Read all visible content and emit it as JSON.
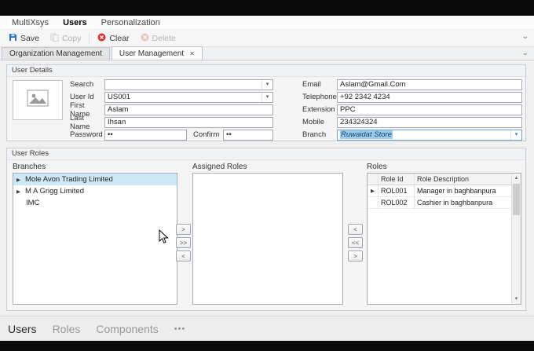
{
  "icons": {
    "chevron_down": "⌄",
    "dropdown": "▾",
    "expander": "▶",
    "row_selector": "▶",
    "scroll_up": "▲",
    "scroll_down": "▼",
    "close": "✕",
    "ellipsis": "•••"
  },
  "menubar": {
    "items": [
      {
        "label": "MultiXsys"
      },
      {
        "label": "Users"
      },
      {
        "label": "Personalization"
      }
    ]
  },
  "toolbar": {
    "buttons": [
      {
        "label": "Save",
        "enabled": true
      },
      {
        "label": "Copy",
        "enabled": false
      },
      {
        "label": "Clear",
        "enabled": true
      },
      {
        "label": "Delete",
        "enabled": false
      }
    ]
  },
  "tabstrip": {
    "tabs": [
      {
        "label": "Organization Management",
        "active": false
      },
      {
        "label": "User Management",
        "active": true
      }
    ]
  },
  "user_details": {
    "title": "User Details",
    "search": {
      "label": "Search",
      "value": ""
    },
    "user_id": {
      "label": "User Id",
      "value": "US001"
    },
    "first_name": {
      "label": "First Name",
      "value": "Aslam"
    },
    "last_name": {
      "label": "Last Name",
      "value": "Ihsan"
    },
    "password": {
      "label": "Password",
      "value": "••"
    },
    "confirm": {
      "label": "Confirm",
      "value": "••"
    },
    "email": {
      "label": "Email",
      "value": "Aslam@Gmail.Com"
    },
    "telephone": {
      "label": "Telephone",
      "value": "+92 2342 4234"
    },
    "extension": {
      "label": "Extension",
      "value": "PPC"
    },
    "mobile": {
      "label": "Mobile",
      "value": "234324324"
    },
    "branch": {
      "label": "Branch",
      "value": "Ruwaidat Store"
    }
  },
  "user_roles": {
    "title": "User Roles",
    "branches": {
      "label": "Branches",
      "items": [
        {
          "label": "Mole Avon Trading Limited",
          "selected": true,
          "has_children": true
        },
        {
          "label": "M A Grigg Limited",
          "selected": false,
          "has_children": true
        },
        {
          "label": "IMC",
          "selected": false,
          "has_children": false
        }
      ]
    },
    "assigned": {
      "label": "Assigned Roles",
      "items": []
    },
    "roles": {
      "label": "Roles",
      "columns": [
        "Role Id",
        "Role Description"
      ],
      "rows": [
        {
          "role_id": "ROL001",
          "description": "Manager in baghbanpura",
          "selected": true
        },
        {
          "role_id": "ROL002",
          "description": "Cashier in baghbanpura",
          "selected": false
        }
      ]
    },
    "transfer_left": [
      ">",
      ">>",
      "<"
    ],
    "transfer_right": [
      "<",
      "<<",
      ">"
    ]
  },
  "statusbar": {
    "items": [
      {
        "label": "Users",
        "active": true
      },
      {
        "label": "Roles",
        "active": false
      },
      {
        "label": "Components",
        "active": false
      }
    ]
  }
}
